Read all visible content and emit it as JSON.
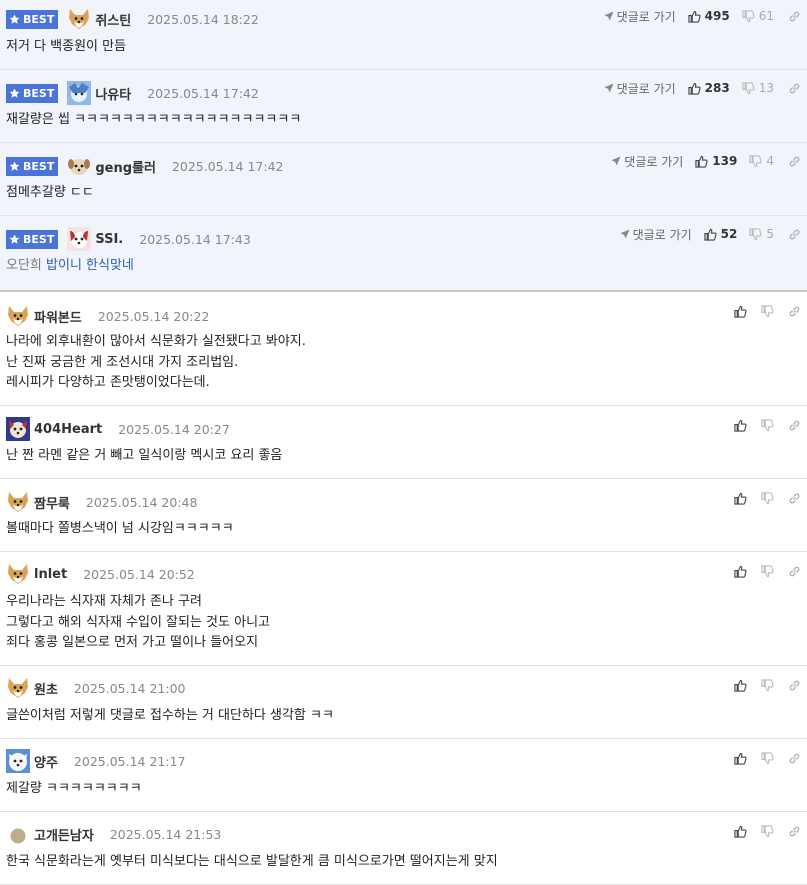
{
  "ui": {
    "best_label": "BEST",
    "reply_label": "댓글로 가기"
  },
  "best_comments": [
    {
      "nick": "쥐스틴",
      "date": "2025.05.14 18:22",
      "text": "저거 다 백종원이 만듬",
      "up": "495",
      "down": "61",
      "avatar": "shiba-avatar"
    },
    {
      "nick": "나유타",
      "date": "2025.05.14 17:42",
      "text": "재갈량은 씹 ㅋㅋㅋㅋㅋㅋㅋㅋㅋㅋㅋㅋㅋㅋㅋㅋㅋㅋㅋ",
      "up": "283",
      "down": "13",
      "avatar": "blue-character-avatar"
    },
    {
      "nick": "geng룰러",
      "date": "2025.05.14 17:42",
      "text": "점메추갈량 ㄷㄷ",
      "up": "139",
      "down": "4",
      "avatar": "puppy-avatar"
    },
    {
      "nick": "SSI.",
      "date": "2025.05.14 17:43",
      "text_plain": "오단희",
      "text_link": "밥이니 한식맞네",
      "up": "52",
      "down": "5",
      "avatar": "red-dog-avatar"
    }
  ],
  "comments": [
    {
      "nick": "파워본드",
      "date": "2025.05.14 20:22",
      "lines": [
        "나라에 외후내환이 많아서 식문화가 실전됐다고 봐야지.",
        "난 진짜 궁금한 게 조선시대 가지 조리법임.",
        "레시피가 다양하고 존맛탱이었다는데."
      ],
      "avatar": "shiba-avatar"
    },
    {
      "nick": "404Heart",
      "date": "2025.05.14 20:27",
      "lines": [
        "난 짠 라멘 같은 거 빼고 일식이랑 멕시코 요리 좋음"
      ],
      "avatar": "heart-dog-avatar"
    },
    {
      "nick": "짬무룩",
      "date": "2025.05.14 20:48",
      "lines": [
        "볼때마다 쫄병스낵이 넘 시강임ㅋㅋㅋㅋㅋ"
      ],
      "avatar": "shiba-avatar"
    },
    {
      "nick": "lnlet",
      "date": "2025.05.14 20:52",
      "lines": [
        "우리나라는 식자재 자체가 존나 구려",
        "그렇다고 해외 식자재 수입이 잘되는 것도 아니고",
        "죄다 홍콩 일본으로 먼저 가고 떨이나 들어오지"
      ],
      "avatar": "shiba-avatar"
    },
    {
      "nick": "원초",
      "date": "2025.05.14 21:00",
      "lines": [
        "글쓴이처럼 저렇게 댓글로 접수하는 거 대단하다 생각함 ㅋㅋ"
      ],
      "avatar": "shiba-avatar"
    },
    {
      "nick": "양주",
      "date": "2025.05.14 21:17",
      "lines": [
        "제갈량 ㅋㅋㅋㅋㅋㅋㅋㅋ"
      ],
      "avatar": "white-dog-avatar"
    },
    {
      "nick": "고개든남자",
      "date": "2025.05.14 21:53",
      "lines": [
        "한국 식문화라는게 옛부터 미식보다는 대식으로 발달한게 큼 미식으로가면 떨어지는게 맞지"
      ],
      "avatar": "default-avatar"
    }
  ],
  "colors": {
    "best_bg": "#f1f4fb",
    "badge": "#4a74d8",
    "link": "#2a5fb8"
  }
}
